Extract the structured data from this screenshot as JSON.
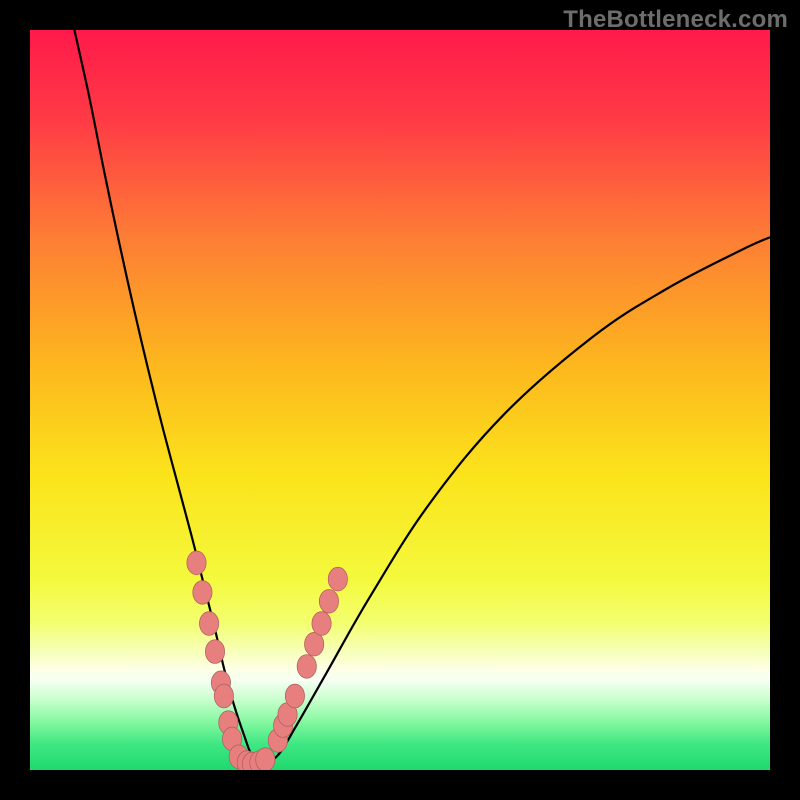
{
  "watermark": "TheBottleneck.com",
  "colors": {
    "gradient_stops": [
      {
        "offset": 0.0,
        "color": "#ff1a4a"
      },
      {
        "offset": 0.12,
        "color": "#ff3a46"
      },
      {
        "offset": 0.28,
        "color": "#fd7d35"
      },
      {
        "offset": 0.45,
        "color": "#fdb61e"
      },
      {
        "offset": 0.6,
        "color": "#fbe31b"
      },
      {
        "offset": 0.74,
        "color": "#f4f93c"
      },
      {
        "offset": 0.8,
        "color": "#f3ff6e"
      },
      {
        "offset": 0.835,
        "color": "#f7ffb0"
      },
      {
        "offset": 0.862,
        "color": "#fdffe2"
      },
      {
        "offset": 0.878,
        "color": "#f7fff3"
      },
      {
        "offset": 0.905,
        "color": "#c8ffcd"
      },
      {
        "offset": 0.935,
        "color": "#84f8a0"
      },
      {
        "offset": 0.965,
        "color": "#3fe782"
      },
      {
        "offset": 1.0,
        "color": "#1fd96e"
      }
    ],
    "curve": "#000000",
    "marker_fill": "#e77f7f",
    "marker_stroke": "#b15e5e",
    "background": "#000000"
  },
  "chart_data": {
    "type": "line",
    "title": "",
    "xlabel": "",
    "ylabel": "",
    "xlim": [
      0,
      1000
    ],
    "ylim": [
      0,
      1000
    ],
    "curve": {
      "comment": "single asymmetric V-shaped curve, y measured upward from plot bottom",
      "x": [
        60,
        80,
        100,
        120,
        140,
        160,
        180,
        200,
        220,
        235,
        250,
        262,
        275,
        290,
        300,
        315,
        335,
        360,
        400,
        460,
        540,
        640,
        760,
        860,
        960,
        1000
      ],
      "y": [
        1000,
        910,
        810,
        715,
        625,
        540,
        460,
        385,
        310,
        250,
        190,
        138,
        90,
        45,
        20,
        10,
        20,
        60,
        130,
        235,
        360,
        480,
        585,
        650,
        702,
        720
      ]
    },
    "series": [
      {
        "name": "left-branch-markers",
        "x": [
          225,
          233,
          242,
          250,
          258,
          262,
          268,
          273
        ],
        "y": [
          280,
          240,
          198,
          160,
          118,
          100,
          64,
          42
        ]
      },
      {
        "name": "valley-markers",
        "x": [
          282,
          293,
          300,
          310,
          318
        ],
        "y": [
          18,
          10,
          8,
          10,
          14
        ]
      },
      {
        "name": "right-branch-markers",
        "x": [
          335,
          342,
          348,
          358,
          374,
          384,
          394,
          404,
          416
        ],
        "y": [
          40,
          60,
          75,
          100,
          140,
          170,
          198,
          228,
          258
        ]
      }
    ]
  }
}
